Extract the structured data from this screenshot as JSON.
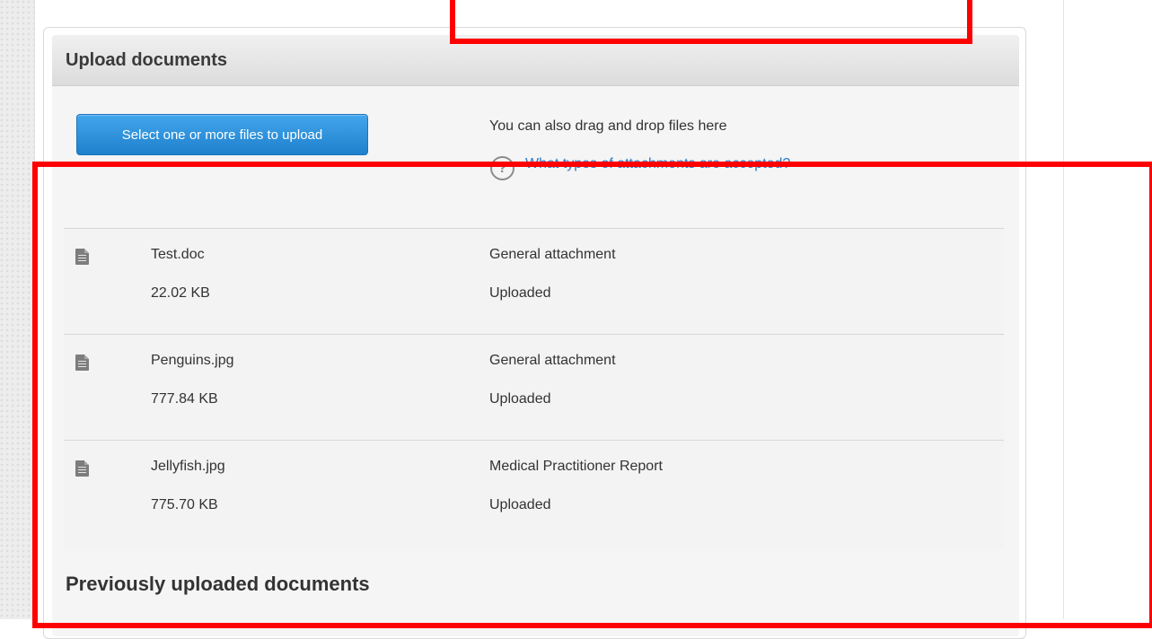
{
  "panel": {
    "title": "Upload documents",
    "upload_button_label": "Select one or more files to upload",
    "drag_drop_text": "You can also drag and drop files here",
    "help_icon_glyph": "?",
    "help_link_text": "What types of attachments are accepted?"
  },
  "files": [
    {
      "name": "Test.doc",
      "size": "22.02 KB",
      "type": "General attachment",
      "status": "Uploaded"
    },
    {
      "name": "Penguins.jpg",
      "size": "777.84 KB",
      "type": "General attachment",
      "status": "Uploaded"
    },
    {
      "name": "Jellyfish.jpg",
      "size": "775.70 KB",
      "type": "Medical Practitioner Report",
      "status": "Uploaded"
    }
  ],
  "previous_section": {
    "title": "Previously uploaded documents"
  },
  "icons": {
    "file": "document-icon",
    "help": "help-circle-icon"
  },
  "colors": {
    "accent": "#1f80cc",
    "link": "#2a78c2",
    "highlight": "#ff0000"
  }
}
